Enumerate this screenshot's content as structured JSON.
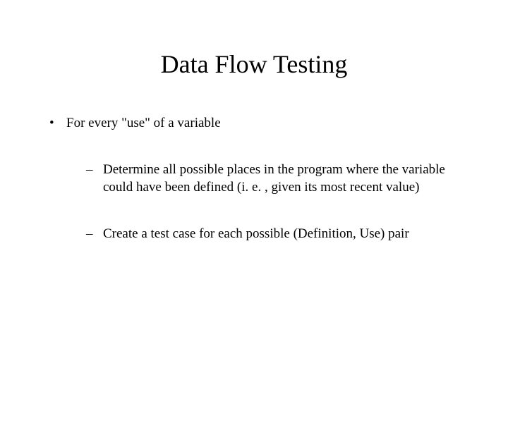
{
  "title": "Data Flow Testing",
  "bullets": {
    "b1": "For every \"use\" of a variable",
    "sub1": "Determine all possible places in the program where the variable could have been defined (i. e. , given its most recent value)",
    "sub2": "Create a test case for each possible (Definition, Use) pair"
  }
}
